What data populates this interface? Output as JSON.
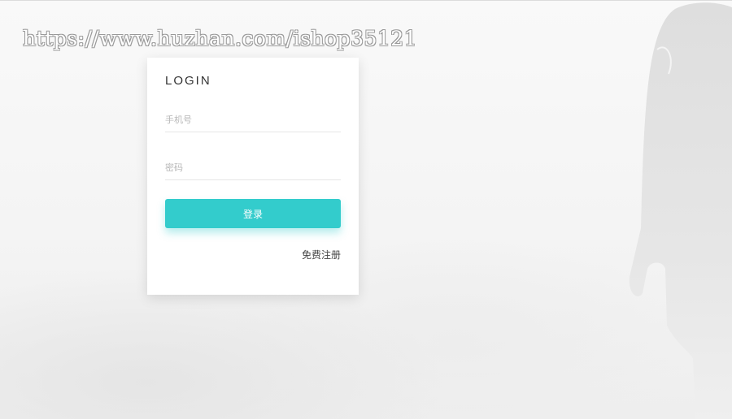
{
  "watermark": {
    "text": "https://www.huzhan.com/ishop35121"
  },
  "login": {
    "title": "LOGIN",
    "phone_placeholder": "手机号",
    "password_placeholder": "密码",
    "submit_label": "登录",
    "register_label": "免费注册"
  },
  "colors": {
    "accent": "#33cccc",
    "card_background": "#ffffff",
    "page_background": "#f7f7f7"
  }
}
